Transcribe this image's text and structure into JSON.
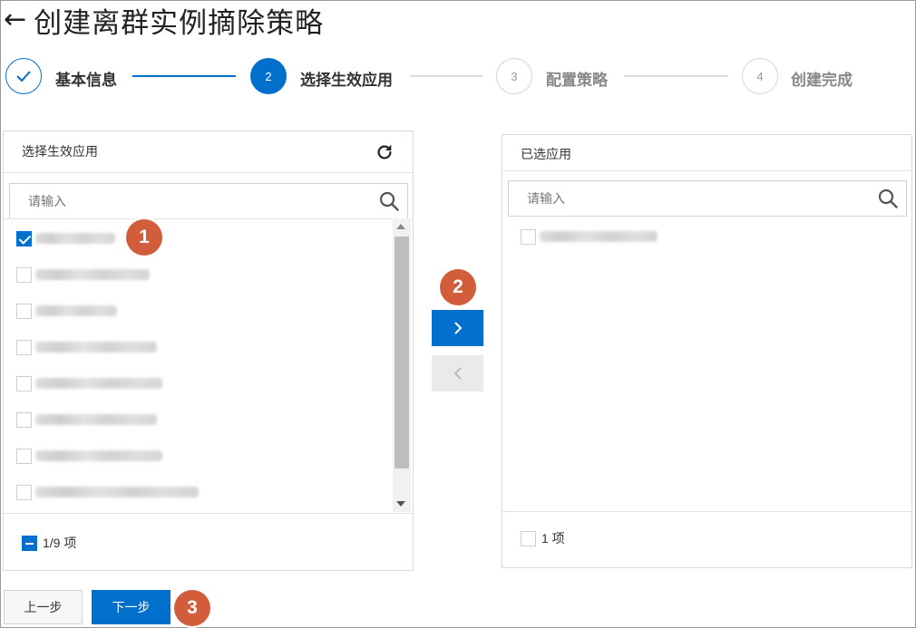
{
  "page": {
    "title": "创建离群实例摘除策略",
    "back_icon": "←"
  },
  "steps": [
    {
      "index": "1",
      "label": "基本信息",
      "state": "done"
    },
    {
      "index": "2",
      "label": "选择生效应用",
      "state": "active"
    },
    {
      "index": "3",
      "label": "配置策略",
      "state": "todo"
    },
    {
      "index": "4",
      "label": "创建完成",
      "state": "todo"
    }
  ],
  "left_panel": {
    "title": "选择生效应用",
    "search_placeholder": "请输入",
    "items_checked": [
      true,
      false,
      false,
      false,
      false,
      false,
      false,
      false
    ],
    "footer_count": "1/9 项"
  },
  "right_panel": {
    "title": "已选应用",
    "search_placeholder": "请输入",
    "items_checked": [
      false
    ],
    "footer_count": "1 项"
  },
  "transfer": {
    "to_right_icon": "chevron-right-icon",
    "to_left_icon": "chevron-left-icon"
  },
  "badges": [
    "1",
    "2",
    "3"
  ],
  "buttons": {
    "prev": "上一步",
    "next": "下一步"
  },
  "colors": {
    "primary": "#0070cc",
    "badge": "#d25d3a",
    "disabled": "#eaeaea"
  }
}
